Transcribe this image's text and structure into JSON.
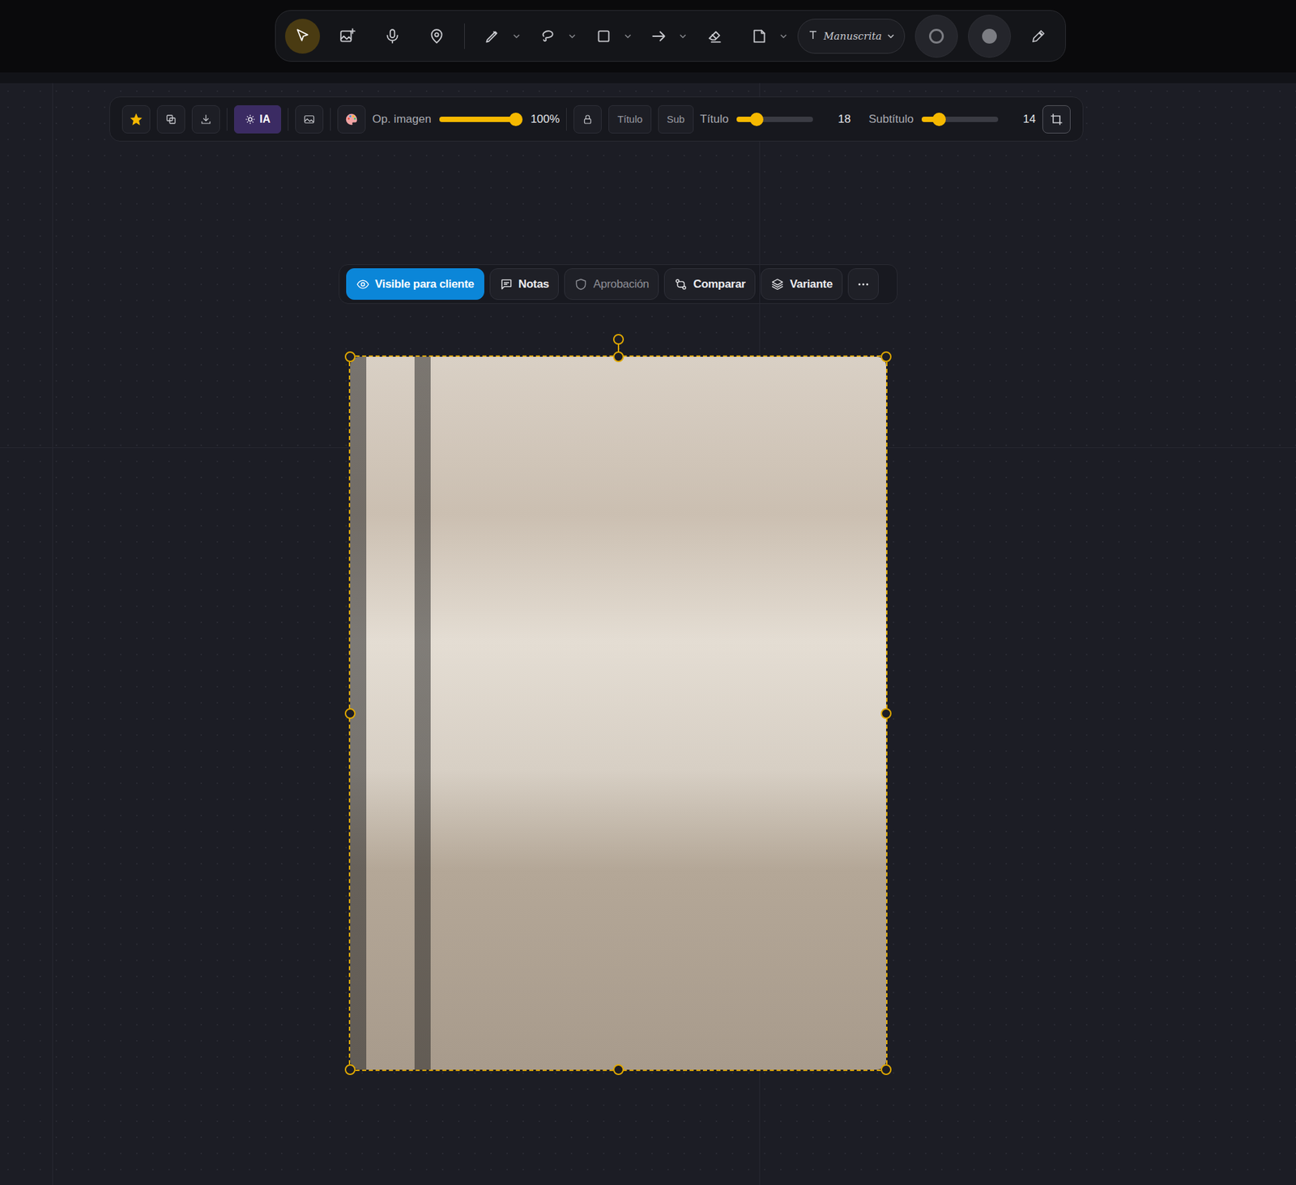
{
  "toolbar": {
    "tools": [
      {
        "selected": true,
        "has_menu": false
      },
      {
        "selected": false,
        "has_menu": false
      },
      {
        "selected": false,
        "has_menu": false
      },
      {
        "selected": false,
        "has_menu": false
      },
      {
        "selected": false,
        "has_menu": true
      },
      {
        "selected": false,
        "has_menu": true
      },
      {
        "selected": false,
        "has_menu": true
      },
      {
        "selected": false,
        "has_menu": true
      },
      {
        "selected": false,
        "has_menu": false
      },
      {
        "selected": false,
        "has_menu": true
      }
    ],
    "font": {
      "label": "Manuscrita"
    },
    "swatches": [
      {
        "kind": "outline"
      },
      {
        "kind": "fill"
      }
    ]
  },
  "properties": {
    "favorite": {
      "on": true
    },
    "ai_button": {
      "label": "IA",
      "selected": true
    },
    "image_opacity": {
      "label": "Op. imagen",
      "level": 1,
      "reading": "100%"
    },
    "title_toggle": "Título",
    "subtitle_toggle": "Sub",
    "title_size": {
      "label": "Título",
      "level": 0.26,
      "reading": "18"
    },
    "subtitle_size": {
      "label": "Subtítulo",
      "level": 0.23,
      "reading": "14"
    }
  },
  "image_actions": [
    {
      "label": "Visible para cliente",
      "selected": true,
      "disabled": false
    },
    {
      "label": "Notas",
      "selected": false,
      "disabled": false
    },
    {
      "label": "Aprobación",
      "selected": false,
      "disabled": true
    },
    {
      "label": "Comparar",
      "selected": false,
      "disabled": false
    },
    {
      "label": "Variante",
      "selected": false,
      "disabled": false
    }
  ],
  "image": {
    "selected": true
  }
}
